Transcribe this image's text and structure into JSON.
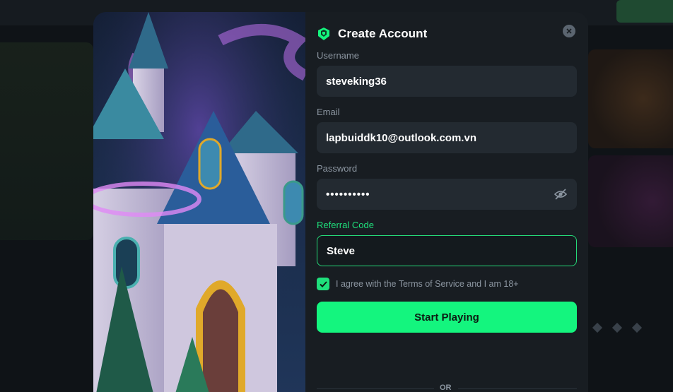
{
  "modal": {
    "title": "Create Account",
    "logo_icon": "shield-logo-icon",
    "close_icon": "close-icon"
  },
  "form": {
    "username": {
      "label": "Username",
      "value": "steveking36"
    },
    "email": {
      "label": "Email",
      "value": "lapbuiddk10@outlook.com.vn"
    },
    "password": {
      "label": "Password",
      "value": "••••••••••",
      "toggle_icon": "eye-slash-icon"
    },
    "referral": {
      "label": "Referral Code",
      "value": "Steve"
    },
    "agree": {
      "text": "I agree with the Terms of Service and I am 18+",
      "checked": true
    },
    "submit_label": "Start Playing",
    "divider_text": "OR"
  },
  "colors": {
    "accent": "#14f57e",
    "panel": "#181d22",
    "field": "#232a31",
    "label": "#8b95a0"
  }
}
